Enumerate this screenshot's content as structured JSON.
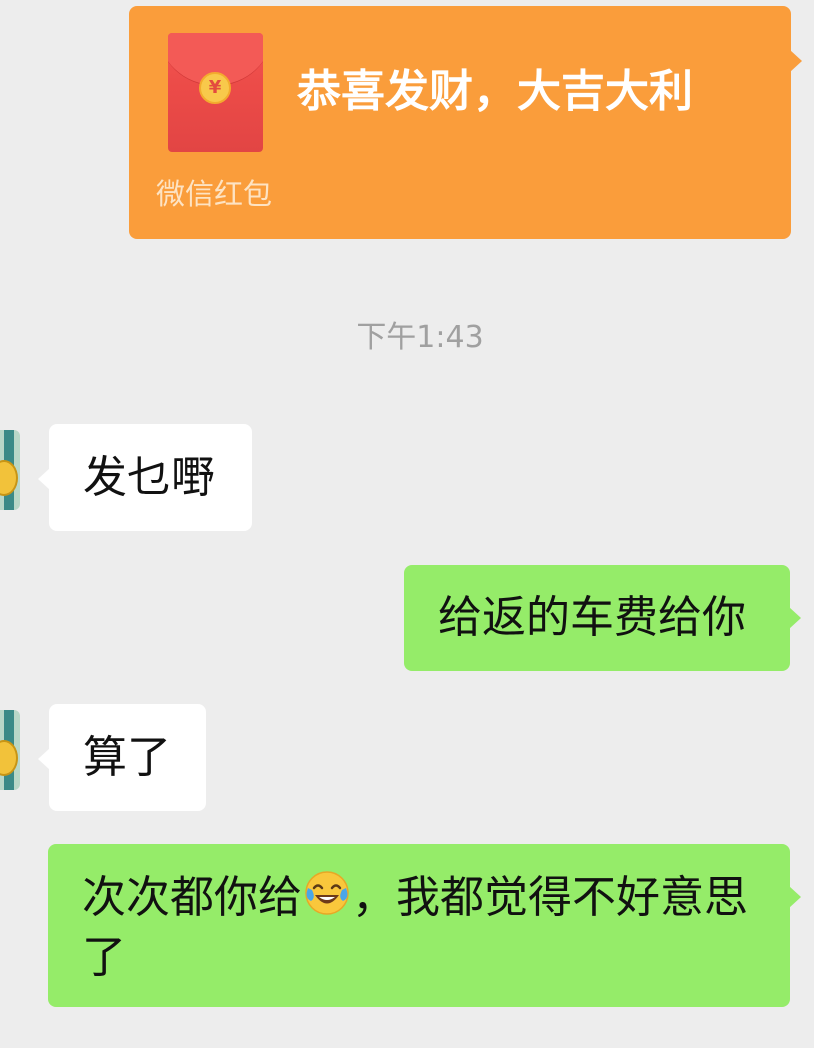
{
  "red_packet": {
    "title": "恭喜发财，大吉大利",
    "footer": "微信红包",
    "coin_symbol": "¥",
    "bg_color": "#fa9d3b"
  },
  "time_separator": "下午1:43",
  "messages": [
    {
      "side": "left",
      "text": "发乜嘢"
    },
    {
      "side": "right",
      "text": "给返的车费给你"
    },
    {
      "side": "left",
      "text": "算了"
    },
    {
      "side": "right",
      "text_before_emoji": "次次都你给",
      "emoji": "crying-laughing-face-icon",
      "text_after_emoji": "，我都觉得不好意思了"
    }
  ],
  "colors": {
    "background": "#ededed",
    "incoming_bubble": "#ffffff",
    "outgoing_bubble": "#95ec69"
  }
}
